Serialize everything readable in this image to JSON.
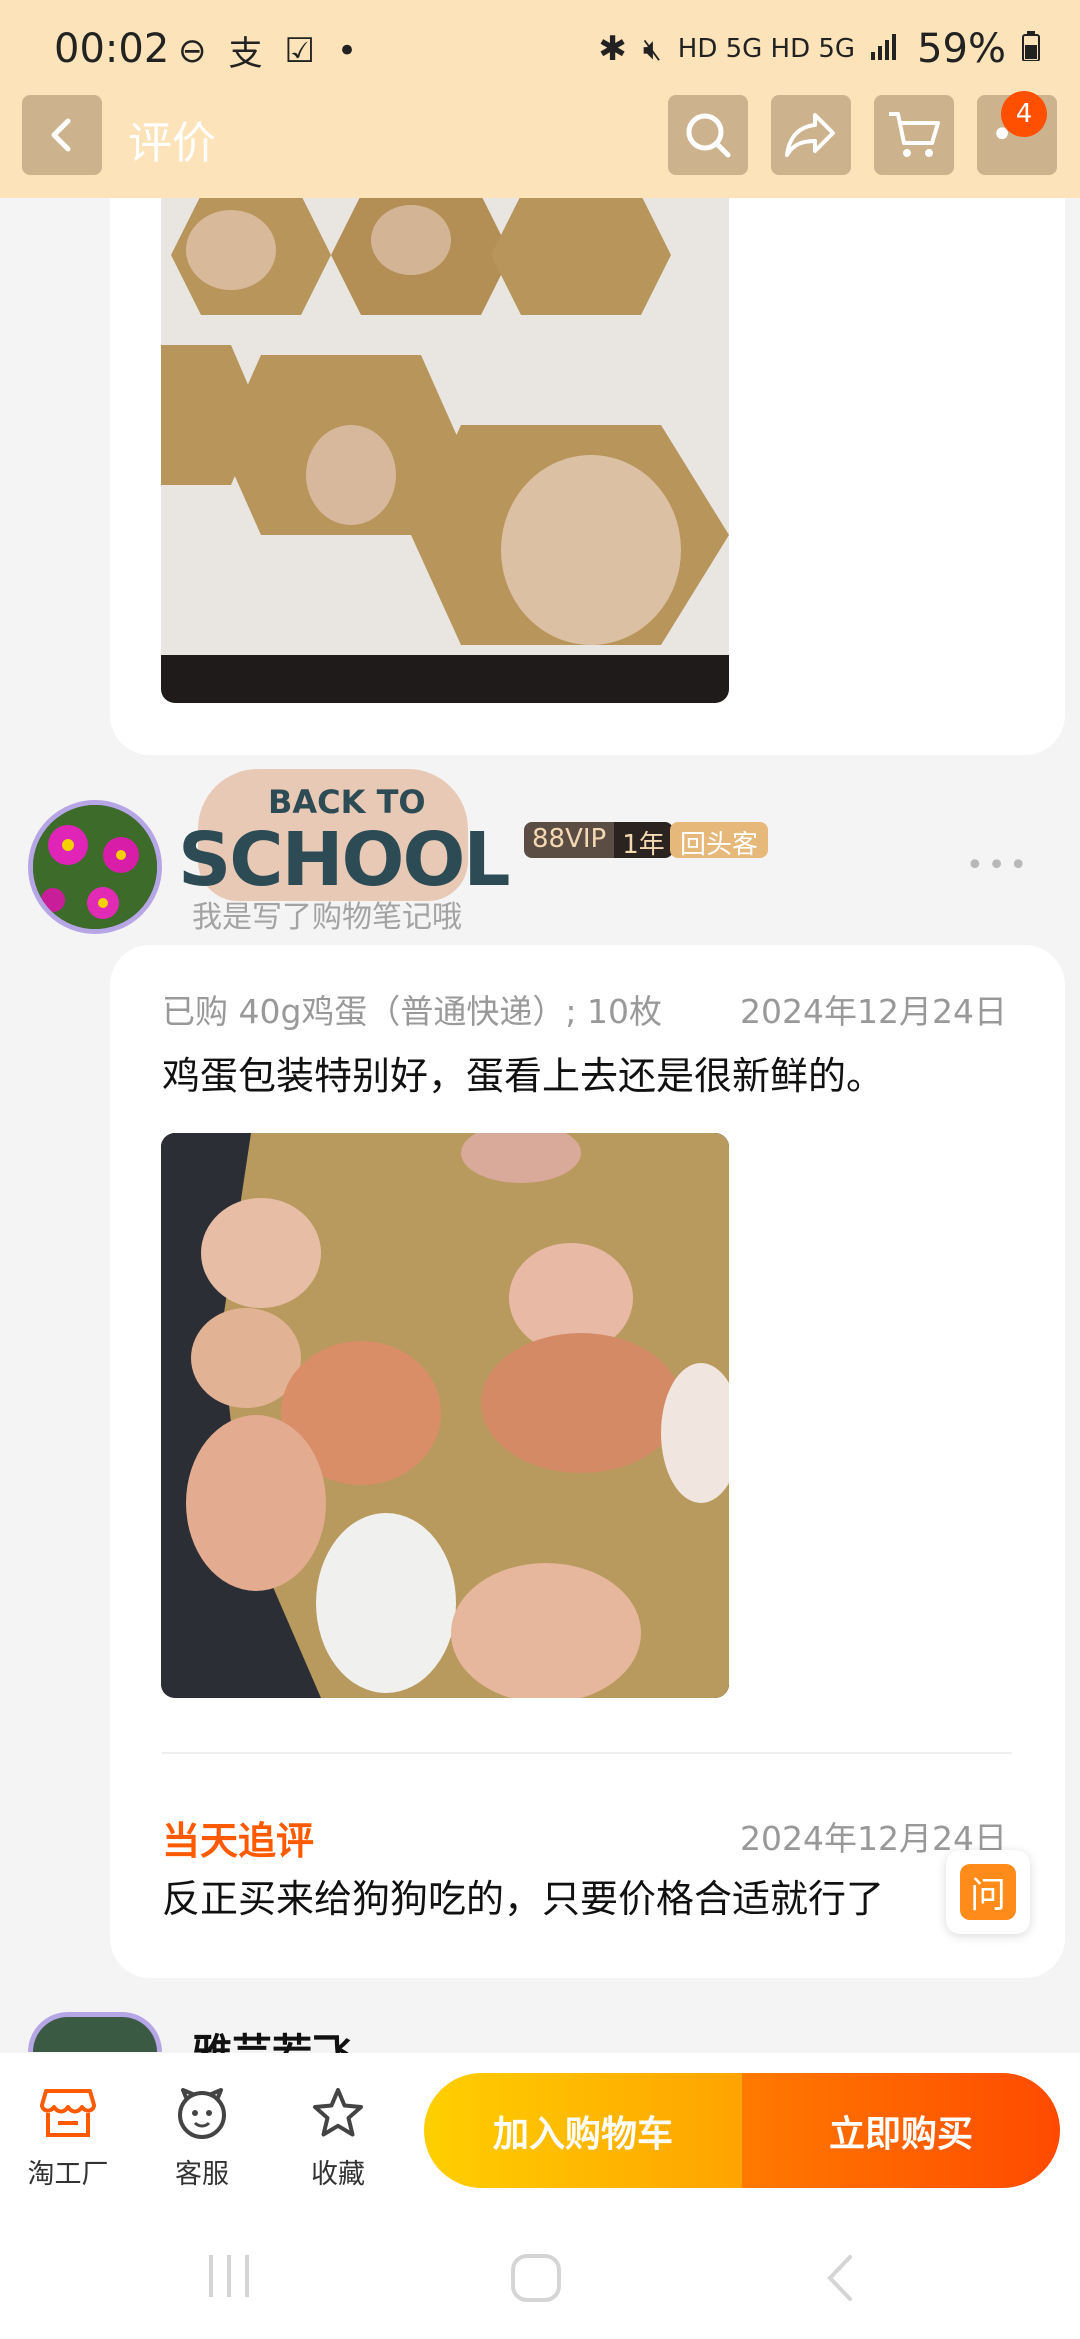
{
  "status_bar": {
    "time": "00:02",
    "network": "HD 5G HD 5G",
    "battery": "59%"
  },
  "header": {
    "title": "评价",
    "cart_badge": "4"
  },
  "reviewer": {
    "sticker_top": "BACK TO",
    "sticker_main": "SCHOOL",
    "subtitle": "我是写了购物笔记哦",
    "vip_label": "88VIP",
    "vip_years": "1年",
    "repeat_tag": "回头客"
  },
  "review": {
    "purchase_meta": "已购 40g鸡蛋（普通快递）; 10枚",
    "date": "2024年12月24日",
    "text": "鸡蛋包装特别好，蛋看上去还是很新鲜的。",
    "follow_label": "当天追评",
    "follow_date": "2024年12月24日",
    "follow_text": "反正买来给狗狗吃的，只要价格合适就行了"
  },
  "ask_button": "问",
  "next_reviewer_name": "雅芸若飞",
  "bottom_bar": {
    "shop_label": "淘工厂",
    "service_label": "客服",
    "favorite_label": "收藏",
    "add_to_cart": "加入购物车",
    "buy_now": "立即购买"
  },
  "colors": {
    "header_bg": "#fde3b9",
    "accent_orange": "#ff5a00",
    "cart_yellow": "#ffb800",
    "buy_orange": "#ff5a00"
  }
}
